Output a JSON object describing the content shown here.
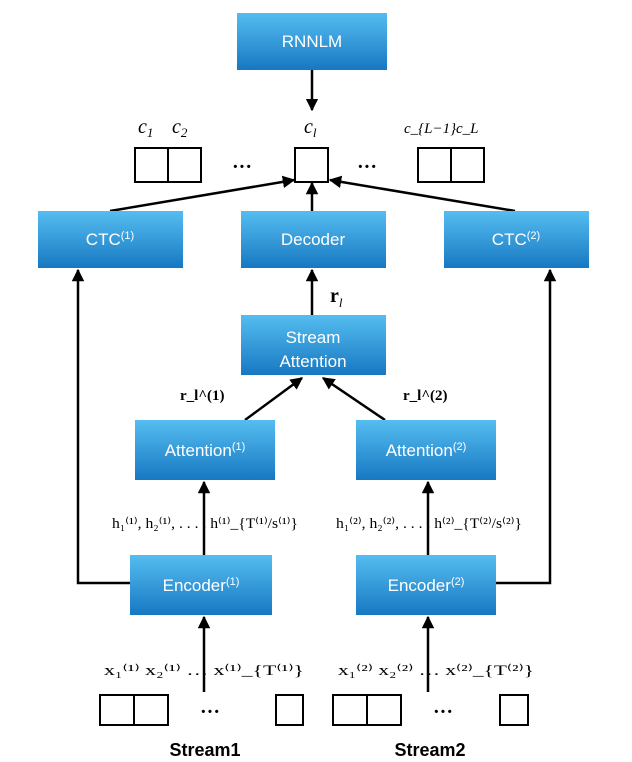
{
  "colors": {
    "box_top": "#55bdf0",
    "box_bottom": "#1778c2",
    "line": "#000000"
  },
  "blocks": {
    "rnnlm": "RNNLM",
    "ctc1": {
      "label": "CTC",
      "sup": "(1)"
    },
    "decoder": "Decoder",
    "ctc2": {
      "label": "CTC",
      "sup": "(2)"
    },
    "stream_attention": [
      "Stream",
      "Attention"
    ],
    "attention1": {
      "label": "Attention",
      "sup": "(1)"
    },
    "attention2": {
      "label": "Attention",
      "sup": "(2)"
    },
    "encoder1": {
      "label": "Encoder",
      "sup": "(1)"
    },
    "encoder2": {
      "label": "Encoder",
      "sup": "(2)"
    }
  },
  "labels": {
    "c1": "c₁",
    "c2": "c₂",
    "cl": "c_l",
    "cLm1": "c_{L−1}",
    "cL": "c_L",
    "rl": "r_l",
    "rl1": "r_l^(1)",
    "rl2": "r_l^(2)",
    "h1": "h₁⁽¹⁾, h₂⁽¹⁾, . . . , h⁽¹⁾_{T⁽¹⁾/s⁽¹⁾}",
    "h2": "h₁⁽²⁾, h₂⁽²⁾, . . . , h⁽²⁾_{T⁽²⁾/s⁽²⁾}",
    "x1": "x₁⁽¹⁾ x₂⁽¹⁾ … x⁽¹⁾_{T⁽¹⁾}",
    "x2": "x₁⁽²⁾ x₂⁽²⁾ … x⁽²⁾_{T⁽²⁾}",
    "dots": "···"
  },
  "streams": [
    "Stream1",
    "Stream2"
  ]
}
